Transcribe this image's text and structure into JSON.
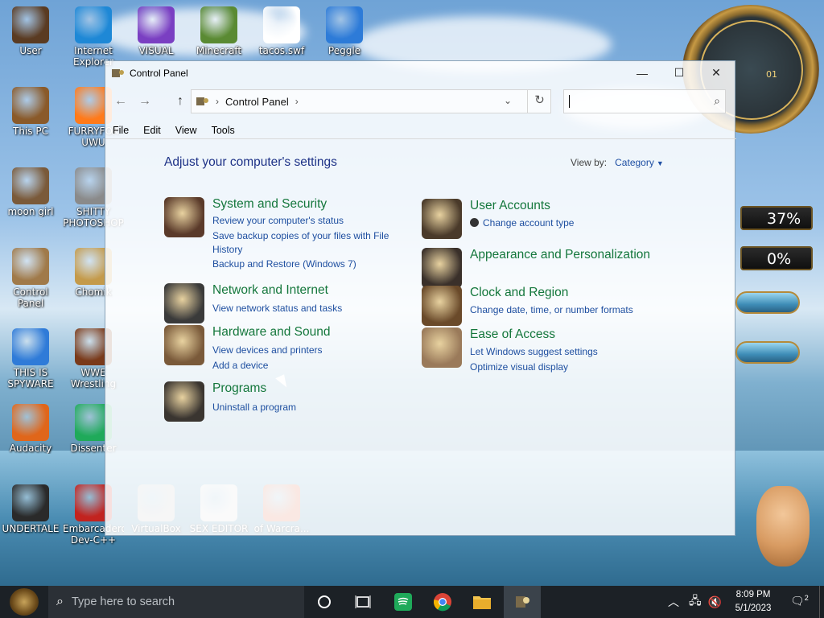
{
  "desktop": {
    "icons": [
      {
        "label": "User",
        "color": "#5a3b22"
      },
      {
        "label": "Internet Explorer",
        "color": "#1e88d6"
      },
      {
        "label": "VISUAL",
        "color": "#7a3fc2"
      },
      {
        "label": "Minecraft",
        "color": "#5a8a33"
      },
      {
        "label": "tacos.swf",
        "color": "#ffffff"
      },
      {
        "label": "Peggle",
        "color": "#2d7bd8"
      },
      {
        "label": "This PC",
        "color": "#8a5a2a"
      },
      {
        "label": "FURRYFOX UWU",
        "color": "#ff7a1a"
      },
      {
        "label": "moon girl",
        "color": "#7a5a3a"
      },
      {
        "label": "SHITTY PHOTOSHOP",
        "color": "#8a8a8a"
      },
      {
        "label": "Control Panel",
        "color": "#a07a4a"
      },
      {
        "label": "Chomik",
        "color": "#c49a4a"
      },
      {
        "label": "THIS IS SPYWARE",
        "color": "#2f7bd8"
      },
      {
        "label": "WWE Wrestling",
        "color": "#7a3a1a"
      },
      {
        "label": "Audacity",
        "color": "#e0661a"
      },
      {
        "label": "Dissenter",
        "color": "#1faa5a"
      },
      {
        "label": "UNDERTALE",
        "color": "#2a2a2a"
      },
      {
        "label": "Embarcadero Dev-C++",
        "color": "#c2231f"
      },
      {
        "label": "VirtualBox",
        "color": "#bbbbbb"
      },
      {
        "label": "SEX EDITOR",
        "color": "#dddddd"
      },
      {
        "label": "of Warcra...",
        "color": "#d8603a"
      }
    ],
    "gauge_1": "37%",
    "gauge_2": "0%",
    "clock_label": "01"
  },
  "window": {
    "title": "Control Panel",
    "controls": {
      "minimize": "—",
      "maximize": "☐",
      "close": "✕"
    },
    "nav": {
      "back": "←",
      "forward": "→",
      "up": "↑",
      "refresh": "↻"
    },
    "address": {
      "crumb": "Control Panel"
    },
    "search": {
      "placeholder": "",
      "value": ""
    },
    "menu": [
      "File",
      "Edit",
      "View",
      "Tools"
    ],
    "heading": "Adjust your computer's settings",
    "view_by": {
      "label": "View by:",
      "value": "Category"
    },
    "categories_left": [
      {
        "title": "System and Security",
        "icon": "system-security-icon",
        "color": "#5a3a2a",
        "links": [
          "Review your computer's status",
          "Save backup copies of your files with File History",
          "Backup and Restore (Windows 7)"
        ]
      },
      {
        "title": "Network and Internet",
        "icon": "network-icon",
        "color": "#3a3a3a",
        "links": [
          "View network status and tasks"
        ]
      },
      {
        "title": "Hardware and Sound",
        "icon": "hardware-icon",
        "color": "#7a5a3a",
        "links": [
          "View devices and printers",
          "Add a device"
        ]
      },
      {
        "title": "Programs",
        "icon": "programs-icon",
        "color": "#3a3530",
        "links": [
          "Uninstall a program"
        ]
      }
    ],
    "categories_right": [
      {
        "title": "User Accounts",
        "icon": "user-accounts-icon",
        "color": "#4a3a2a",
        "links": [
          "Change account type"
        ]
      },
      {
        "title": "Appearance and Personalization",
        "icon": "appearance-icon",
        "color": "#3a302a",
        "links": []
      },
      {
        "title": "Clock and Region",
        "icon": "clock-region-icon",
        "color": "#6a4a2a",
        "links": [
          "Change date, time, or number formats"
        ]
      },
      {
        "title": "Ease of Access",
        "icon": "ease-of-access-icon",
        "color": "#9a7a5a",
        "links": [
          "Let Windows suggest settings",
          "Optimize visual display"
        ]
      }
    ]
  },
  "taskbar": {
    "search_placeholder": "Type here to search",
    "time": "8:09 PM",
    "date": "5/1/2023",
    "notification_count": "2"
  }
}
